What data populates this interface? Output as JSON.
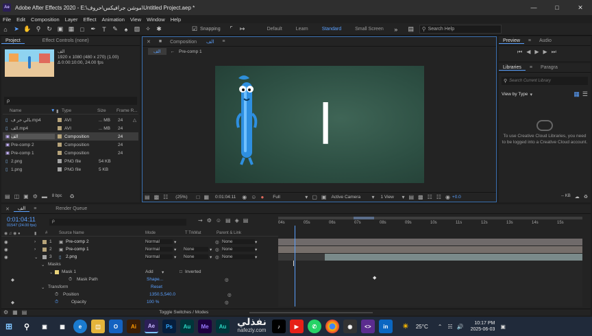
{
  "window": {
    "title": "Adobe After Effects 2020 - E:\\موشن جرافيكس\\حروف\\Untitled Project.aep *",
    "app_icon": "Ae"
  },
  "menu": [
    "File",
    "Edit",
    "Composition",
    "Layer",
    "Effect",
    "Animation",
    "View",
    "Window",
    "Help"
  ],
  "toolbar": {
    "snapping": "Snapping",
    "workspaces": [
      "Default",
      "Learn",
      "Standard",
      "Small Screen"
    ],
    "active_workspace": "Standard",
    "search_placeholder": "Search Help"
  },
  "project": {
    "tabs": [
      "Project",
      "Effect Controls (none)"
    ],
    "selected": {
      "name": "الف",
      "dims": "1920 x 1080  (480 x 270) (1.00)",
      "dur": "Δ 0:00:10:00, 24.00 fps"
    },
    "search_placeholder": "ρ",
    "headers": [
      "Name",
      "Type",
      "Size",
      "Frame R..."
    ],
    "items": [
      {
        "name": "بالي حر ف.mp4",
        "type": "AVI",
        "size": "... MB",
        "fr": "24",
        "color": "#b7a47a"
      },
      {
        "name": "الف.mp4",
        "type": "AVI",
        "size": "... MB",
        "fr": "24",
        "color": "#b7a47a"
      },
      {
        "name": "الف",
        "type": "Composition",
        "size": "",
        "fr": "24",
        "color": "#b7a47a"
      },
      {
        "name": "Pre-comp 2",
        "type": "Composition",
        "size": "",
        "fr": "24",
        "color": "#b7a47a"
      },
      {
        "name": "Pre-comp 1",
        "type": "Composition",
        "size": "",
        "fr": "24",
        "color": "#b7a47a"
      },
      {
        "name": "2.png",
        "type": "PNG file",
        "size": "54 KB",
        "fr": "",
        "color": "#a3a3a3"
      },
      {
        "name": "1.png",
        "type": "PNG file",
        "size": "5 KB",
        "fr": "",
        "color": "#a3a3a3"
      }
    ],
    "bpc": "8 bpc"
  },
  "composition": {
    "tab": "Composition",
    "tab_name": "الف",
    "subtabs": [
      "الف",
      "Pre-comp 1"
    ],
    "letter": "ا",
    "footer": {
      "zoom": "(25%)",
      "time": "0:01:04:11",
      "res": "Full",
      "camera": "Active Camera",
      "view": "1 View",
      "exposure": "+0.0"
    }
  },
  "right": {
    "preview_tabs": [
      "Preview",
      "Audio"
    ],
    "libraries_tabs": [
      "Libraries",
      "Paragra"
    ],
    "search_placeholder": "Search Current Library",
    "view_by": "View by Type",
    "cc_message": "To use Creative Cloud Libraries, you need to be logged into a Creative Cloud account.",
    "kb_label": "-- KB"
  },
  "timeline": {
    "tabs": [
      "الف",
      "Render Queue"
    ],
    "time": "0:01:04:11",
    "frames": "01547 (24.00 fps)",
    "search_placeholder": "ρ",
    "headers": [
      "#",
      "Source Name",
      "Mode",
      "T TrkMat",
      "Parent & Link"
    ],
    "ruler": [
      "04s",
      "05s",
      "06s",
      "07s",
      "08s",
      "09s",
      "10s",
      "11s",
      "12s",
      "13s",
      "14s",
      "15s"
    ],
    "layers": [
      {
        "num": "1",
        "name": "Pre-comp 2",
        "mode": "Normal",
        "trk": "",
        "parent": "None",
        "color": "#b7a47a"
      },
      {
        "num": "2",
        "name": "Pre-comp 1",
        "mode": "Normal",
        "trk": "None",
        "parent": "None",
        "color": "#b7a47a"
      },
      {
        "num": "3",
        "name": "2.png",
        "mode": "Normal",
        "trk": "None",
        "parent": "None",
        "color": "#a3a3a3"
      }
    ],
    "props": {
      "masks": "Masks",
      "mask1": "Mask 1",
      "mask_mode": "Add",
      "inverted": "Inverted",
      "mask_path": "Mask Path",
      "shape": "Shape...",
      "transform": "Transform",
      "reset": "Reset",
      "position": "Position",
      "position_val": "1350.5,540.0",
      "opacity": "Opacity",
      "opacity_val": "100 %"
    },
    "footer": "Toggle Switches / Modes"
  },
  "taskbar": {
    "weather": "25°C",
    "time": "10:17 PM",
    "date": "2025-06-03",
    "watermark": "نفذلي",
    "watermark_site": "nafezly.com",
    "apps": [
      "Ai",
      "Ae",
      "Ps",
      "Au",
      "Me",
      "Au"
    ]
  }
}
